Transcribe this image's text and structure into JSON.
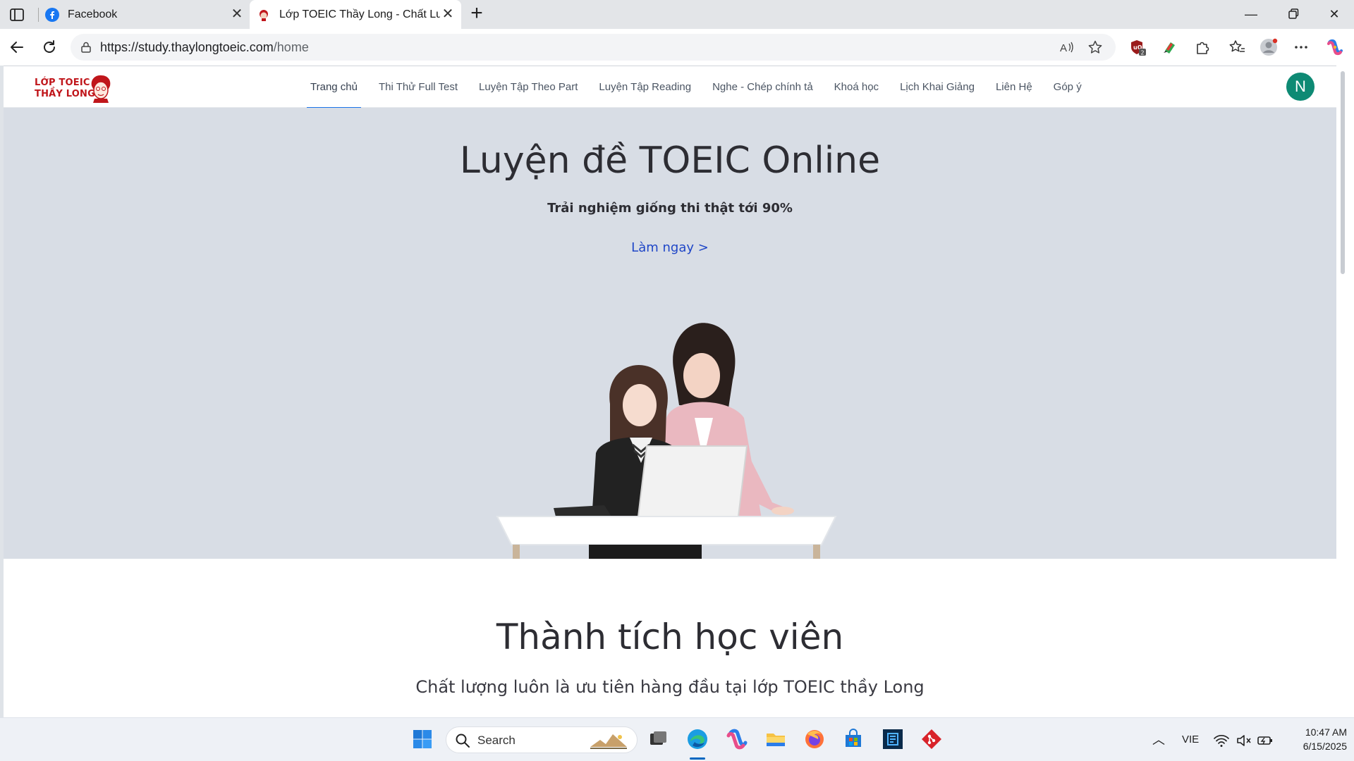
{
  "browser": {
    "tabs": [
      {
        "title": "Facebook",
        "favicon": "facebook-icon",
        "active": false
      },
      {
        "title": "Lớp TOEIC Thầy Long - Chất Lượng",
        "favicon": "thaylong-favicon",
        "active": true
      }
    ],
    "url_host": "https://study.thaylongtoeic.com",
    "url_path": "/home",
    "extension_badge": "2"
  },
  "site": {
    "logo_line1": "LỚP TOEIC",
    "logo_line2": "THẦY LONG",
    "menu": [
      "Trang chủ",
      "Thi Thử Full Test",
      "Luyện Tập Theo Part",
      "Luyện Tập Reading",
      "Nghe - Chép chính tả",
      "Khoá học",
      "Lịch Khai Giảng",
      "Liên Hệ",
      "Góp ý"
    ],
    "active_menu": "Trang chủ",
    "avatar_letter": "N",
    "accent_color": "#1a73e8",
    "avatar_color": "#0e8a74"
  },
  "hero": {
    "title": "Luyện đề TOEIC Online",
    "subtitle": "Trải nghiệm giống thi thật tới 90%",
    "cta": "Làm ngay >",
    "background": "#d8dde5"
  },
  "achievements": {
    "title": "Thành tích học viên",
    "subtitle": "Chất lượng luôn là ưu tiên hàng đầu tại lớp TOEIC thầy Long"
  },
  "taskbar": {
    "search_placeholder": "Search",
    "language": "VIE",
    "time": "10:47 AM",
    "date": "6/15/2025"
  }
}
